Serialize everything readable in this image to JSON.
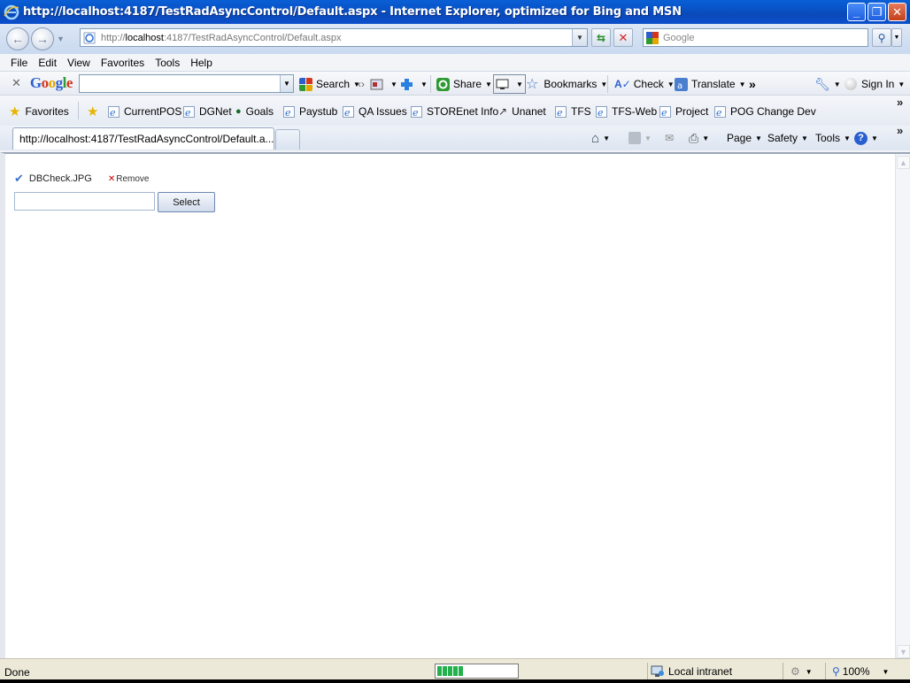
{
  "window": {
    "title": "http://localhost:4187/TestRadAsyncControl/Default.aspx - Internet Explorer, optimized for Bing and MSN"
  },
  "address_bar": {
    "url_prefix": "http://",
    "url_host": "localhost",
    "url_rest": ":4187/TestRadAsyncControl/Default.aspx",
    "search_placeholder": "Google"
  },
  "menu": {
    "items": [
      "File",
      "Edit",
      "View",
      "Favorites",
      "Tools",
      "Help"
    ]
  },
  "google_toolbar": {
    "logo": "Google",
    "search_label": "Search",
    "share_label": "Share",
    "bookmarks_label": "Bookmarks",
    "check_label": "Check",
    "translate_label": "Translate",
    "more_label": "»",
    "signin_label": "Sign In"
  },
  "favorites_bar": {
    "favorites_label": "Favorites",
    "items": [
      "CurrentPOS",
      "DGNet",
      "Goals",
      "Paystub",
      "QA Issues",
      "STOREnet Info",
      "Unanet",
      "TFS",
      "TFS-Web",
      "Project",
      "POG Change Dev"
    ]
  },
  "tabs": {
    "active_tab": "http://localhost:4187/TestRadAsyncControl/Default.a..."
  },
  "command_bar": {
    "page_label": "Page",
    "safety_label": "Safety",
    "tools_label": "Tools"
  },
  "content": {
    "uploaded_file": "DBCheck.JPG",
    "remove_label": "Remove",
    "select_label": "Select",
    "file_input_value": ""
  },
  "status_bar": {
    "status_text": "Done",
    "zone_text": "Local intranet",
    "zoom_text": "100%",
    "progress_fraction": 0.3
  },
  "colors": {
    "titlebar": "#0a5fd6",
    "progress": "#22b14c",
    "remove_x": "#cc0000",
    "check": "#3b74c7"
  }
}
